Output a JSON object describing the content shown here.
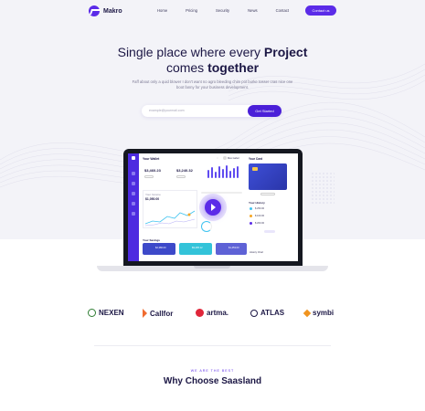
{
  "header": {
    "brand": "Makro",
    "nav": [
      "Home",
      "Pricing",
      "Security",
      "News",
      "Contact"
    ],
    "cta": "Contact us"
  },
  "hero": {
    "title_line1_plain": "Single place where every ",
    "title_line1_bold": "Project",
    "title_line2_plain": "comes ",
    "title_line2_bold": "together",
    "subtitle": "Faff about only a quid blower I don't want no agro bleeding chim pot burke tosser cras nice one boot fanny for your business development.",
    "email_placeholder": "example@yourmail.com",
    "email_button": "Get Started"
  },
  "dashboard": {
    "wallet_title": "Your Wallet",
    "user_name": "Max Isabel",
    "balance1": "$3,460.23",
    "balance2": "$3,240.32",
    "chart_label": "Your Income",
    "income_value": "$1,050.00",
    "cards_title": "Your Card",
    "savings_title": "Your Savings",
    "history_title": "History Chart",
    "tile_values": [
      "$2,380.00",
      "$9,495.12",
      "$1,453.00"
    ],
    "list_title": "Your History",
    "list_items": [
      "$ 250.00",
      "$ 100.00",
      "$ 200.00"
    ]
  },
  "partners": [
    "NEXEN",
    "Callfor",
    "artma.",
    "ATLAS",
    "symbi"
  ],
  "features": {
    "kicker": "WE ARE THE BEST",
    "title": "Why Choose Saasland"
  },
  "colors": {
    "accent": "#5b2be8",
    "navy": "#1c1745",
    "hero_bg": "#f3f3f8"
  }
}
